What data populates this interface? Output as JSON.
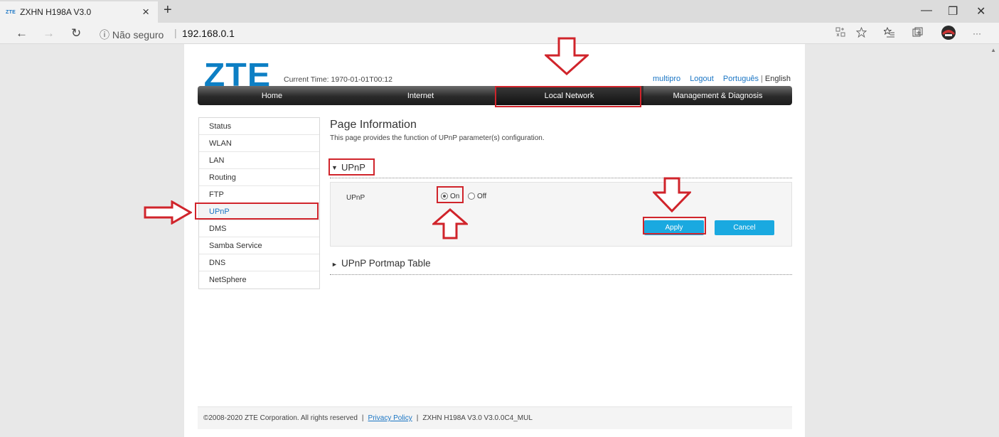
{
  "browser": {
    "tab_favicon": "ZTE",
    "tab_title": "ZXHN H198A V3.0",
    "tab_close": "×",
    "new_tab": "+",
    "minimize": "—",
    "restore": "❐",
    "close_window": "✕",
    "back": "←",
    "forward": "→",
    "refresh": "↻",
    "security_label": "ⓘ Não seguro",
    "separator": "|",
    "url": "192.168.0.1",
    "more": "···"
  },
  "header": {
    "logo": "ZTE",
    "current_time": "Current Time: 1970-01-01T00:12",
    "user": "multipro",
    "logout": "Logout",
    "lang_pt": "Português",
    "lang_sep": "|",
    "lang_en": "English"
  },
  "menu": {
    "items": [
      "Home",
      "Internet",
      "Local Network",
      "Management & Diagnosis"
    ],
    "active": "Local Network"
  },
  "sidebar": {
    "items": [
      "Status",
      "WLAN",
      "LAN",
      "Routing",
      "FTP",
      "UPnP",
      "DMS",
      "Samba Service",
      "DNS",
      "NetSphere"
    ],
    "active": "UPnP"
  },
  "main": {
    "page_title": "Page Information",
    "page_desc": "This page provides the function of UPnP parameter(s) configuration.",
    "section_arrow": "▼",
    "section_title": "UPnP",
    "field_label": "UPnP",
    "option_on": "On",
    "option_off": "Off",
    "upnp_value": "On",
    "apply": "Apply",
    "cancel": "Cancel",
    "section2_arrow": "►",
    "section2_title": "UPnP Portmap Table"
  },
  "footer": {
    "copyright": "©2008-2020 ZTE Corporation. All rights reserved",
    "pipe": "|",
    "privacy": "Privacy Policy",
    "version": "ZXHN H198A V3.0 V3.0.0C4_MUL"
  },
  "colors": {
    "brand": "#0d7fc4",
    "button": "#1aa9e0",
    "annotation": "#d0242b"
  }
}
